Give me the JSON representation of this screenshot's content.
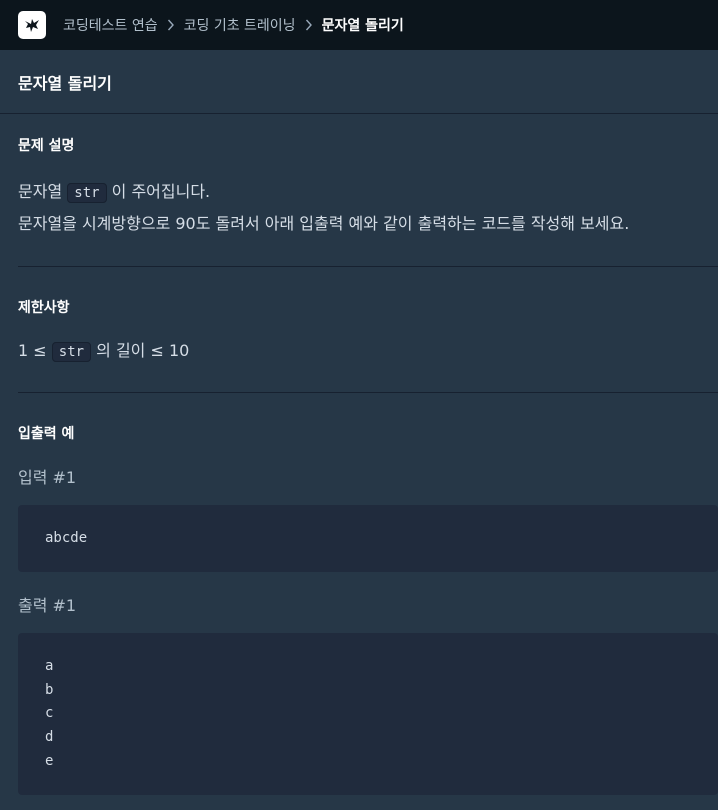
{
  "breadcrumb": {
    "items": [
      "코딩테스트 연습",
      "코딩 기초 트레이닝",
      "문자열 돌리기"
    ]
  },
  "page": {
    "title": "문자열 돌리기"
  },
  "description": {
    "heading": "문제 설명",
    "line1_before": "문자열",
    "line1_code": "str",
    "line1_after": "이 주어집니다.",
    "line2": "문자열을 시계방향으로 90도 돌려서 아래 입출력 예와 같이 출력하는 코드를 작성해 보세요."
  },
  "constraints": {
    "heading": "제한사항",
    "before": "1 ≤",
    "code": "str",
    "after": "의 길이 ≤ 10"
  },
  "io": {
    "heading": "입출력 예",
    "input_label": "입력 #1",
    "input_value": "abcde",
    "output_label": "출력 #1",
    "output_lines": [
      "a",
      "b",
      "c",
      "d",
      "e"
    ]
  },
  "colors": {
    "background": "#263747",
    "topbar": "#0c151c",
    "code_block": "#202b3d"
  }
}
